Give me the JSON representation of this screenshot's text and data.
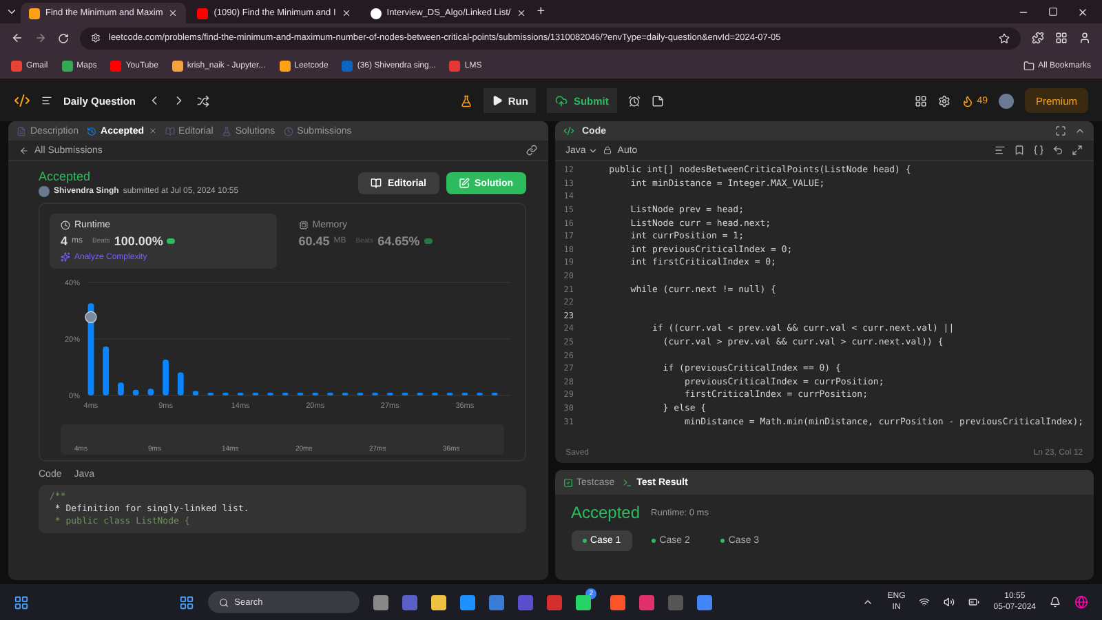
{
  "browser": {
    "tabs": [
      {
        "title": "Find the Minimum and Maxim",
        "selected": true,
        "kind": "leetcode"
      },
      {
        "title": "(1090) Find the Minimum and I",
        "selected": false,
        "kind": "youtube"
      },
      {
        "title": "Interview_DS_Algo/Linked List/",
        "selected": false,
        "kind": "github"
      }
    ],
    "new_tab": "+",
    "url": "leetcode.com/problems/find-the-minimum-and-maximum-number-of-nodes-between-critical-points/submissions/1310082046/?envType=daily-question&envId=2024-07-05",
    "bookmarks": [
      {
        "label": "Gmail",
        "color": "#ea4335"
      },
      {
        "label": "Maps",
        "color": "#34a853"
      },
      {
        "label": "YouTube",
        "color": "#ff0000"
      },
      {
        "label": "krish_naik - Jupyter...",
        "color": "#f4a340"
      },
      {
        "label": "Leetcode",
        "color": "#ffa116"
      },
      {
        "label": "(36) Shivendra sing...",
        "color": "#0a66c2"
      },
      {
        "label": "LMS",
        "color": "#e53935"
      }
    ],
    "all_bookmarks": "All Bookmarks"
  },
  "nav": {
    "title": "Daily Question",
    "run": "Run",
    "submit": "Submit",
    "streak": "49",
    "premium": "Premium"
  },
  "left": {
    "tabs": [
      {
        "label": "Description",
        "selected": false
      },
      {
        "label": "Accepted",
        "selected": true,
        "closable": true
      },
      {
        "label": "Editorial",
        "selected": false
      },
      {
        "label": "Solutions",
        "selected": false
      },
      {
        "label": "Submissions",
        "selected": false
      }
    ],
    "back": "All Submissions",
    "status": "Accepted",
    "user": "Shivendra Singh",
    "submitted": "submitted at Jul 05, 2024 10:55",
    "buttons": [
      {
        "label": "Editorial",
        "kind": "secondary"
      },
      {
        "label": "Solution",
        "kind": "primary"
      }
    ],
    "stats": [
      {
        "title": "Runtime",
        "value": "4",
        "unit": "ms",
        "beats_label": "Beats",
        "beats": "100.00%",
        "selected": true,
        "link": "Analyze Complexity"
      },
      {
        "title": "Memory",
        "value": "60.45",
        "unit": "MB",
        "beats_label": "Beats",
        "beats": "64.65%",
        "selected": false
      }
    ],
    "chart_data": {
      "type": "bar",
      "categories": [
        "4ms",
        null,
        null,
        null,
        null,
        "9ms",
        null,
        null,
        null,
        null,
        "14ms",
        null,
        null,
        null,
        null,
        "20ms",
        null,
        null,
        null,
        null,
        "27ms",
        null,
        null,
        null,
        null,
        "36ms",
        null,
        null
      ],
      "values": [
        32.6,
        17.3,
        4.6,
        2,
        2.4,
        12.7,
        8.2,
        1.6,
        0.5,
        0.5,
        0.5,
        0.5,
        0.5,
        0.5,
        0.5,
        0.5,
        0.5,
        0.5,
        0.5,
        0.5,
        0.5,
        0.5,
        0.5,
        0.5,
        0.5,
        0.5,
        0.5,
        0.5
      ],
      "ylim": [
        0,
        40
      ],
      "yticks": [
        {
          "value": 0,
          "label": "0%"
        },
        {
          "value": 20,
          "label": "20%"
        },
        {
          "value": 40,
          "label": "40%"
        }
      ]
    },
    "overview_labels": [
      "4ms",
      "9ms",
      "14ms",
      "20ms",
      "27ms",
      "36ms"
    ],
    "code_label": "Code",
    "code_lang": "Java",
    "code": [
      "/**",
      " * Definition for singly-linked list.",
      " * public class ListNode {"
    ]
  },
  "right": {
    "title": "Code",
    "language": "Java",
    "mode": "Auto",
    "lines": [
      {
        "n": "12",
        "text": "    public int[] nodesBetweenCriticalPoints(ListNode head) {"
      },
      {
        "n": "13",
        "text": "        int minDistance = Integer.MAX_VALUE;"
      },
      {
        "n": "14"
      },
      {
        "n": "15",
        "text": "        ListNode prev = head;"
      },
      {
        "n": "16",
        "text": "        ListNode curr = head.next;"
      },
      {
        "n": "17",
        "text": "        int currPosition = 1;"
      },
      {
        "n": "18",
        "text": "        int previousCriticalIndex = 0;"
      },
      {
        "n": "19",
        "text": "        int firstCriticalIndex = 0;"
      },
      {
        "n": "20"
      },
      {
        "n": "21",
        "text": "        while (curr.next != null) {"
      },
      {
        "n": "22"
      },
      {
        "n": "23"
      },
      {
        "n": "24",
        "text": "            if ((curr.val < prev.val && curr.val < curr.next.val) ||"
      },
      {
        "n": "25",
        "text": "              (curr.val > prev.val && curr.val > curr.next.val)) {"
      },
      {
        "n": "26"
      },
      {
        "n": "27",
        "text": "              if (previousCriticalIndex == 0) {"
      },
      {
        "n": "28",
        "text": "                  previousCriticalIndex = currPosition;"
      },
      {
        "n": "29",
        "text": "                  firstCriticalIndex = currPosition;"
      },
      {
        "n": "30",
        "text": "              } else {"
      },
      {
        "n": "31",
        "text": "                  minDistance = Math.min(minDistance, currPosition - previousCriticalIndex);"
      }
    ],
    "saved": "Saved",
    "cursor": "Ln 23, Col 12",
    "result_tabs": [
      {
        "label": "Testcase",
        "selected": false
      },
      {
        "label": "Test Result",
        "selected": true
      }
    ],
    "result": "Accepted",
    "runtime": "Runtime: 0 ms",
    "cases": [
      {
        "label": "Case 1",
        "selected": true
      },
      {
        "label": "Case 2",
        "selected": false
      },
      {
        "label": "Case 3",
        "selected": false
      }
    ]
  },
  "taskbar": {
    "search": "Search",
    "badge": "2",
    "lang": "ENG",
    "region": "IN",
    "time": "10:55",
    "date": "05-07-2024"
  }
}
